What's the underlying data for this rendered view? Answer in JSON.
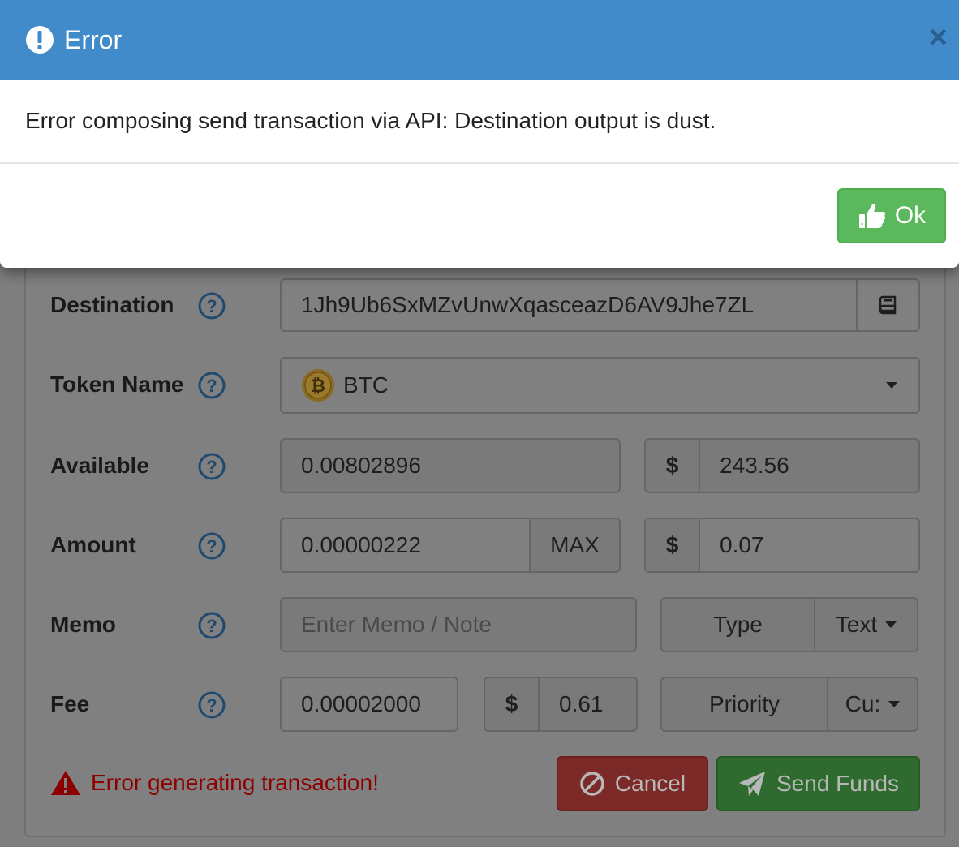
{
  "modal": {
    "title": "Error",
    "close_label": "×",
    "message": "Error composing send transaction via API: Destination output is dust.",
    "ok_label": "Ok",
    "header_color": "#428bca",
    "ok_color": "#5cb85c"
  },
  "form": {
    "destination": {
      "label": "Destination",
      "value": "1Jh9Ub6SxMZvUnwXqasceazD6AV9Jhe7ZL"
    },
    "token": {
      "label": "Token Name",
      "value": "BTC"
    },
    "available": {
      "label": "Available",
      "value": "0.00802896",
      "usd_symbol": "$",
      "usd_value": "243.56"
    },
    "amount": {
      "label": "Amount",
      "value": "0.00000222",
      "max_label": "MAX",
      "usd_symbol": "$",
      "usd_value": "0.07"
    },
    "memo": {
      "label": "Memo",
      "placeholder": "Enter Memo / Note",
      "type_label": "Type",
      "type_value": "Text"
    },
    "fee": {
      "label": "Fee",
      "value": "0.00002000",
      "usd_symbol": "$",
      "usd_value": "0.61",
      "priority_label": "Priority",
      "priority_value": "Cu:"
    }
  },
  "status": {
    "error_text": "Error generating transaction!",
    "error_color": "#8c0000"
  },
  "actions": {
    "cancel_label": "Cancel",
    "send_label": "Send Funds"
  }
}
